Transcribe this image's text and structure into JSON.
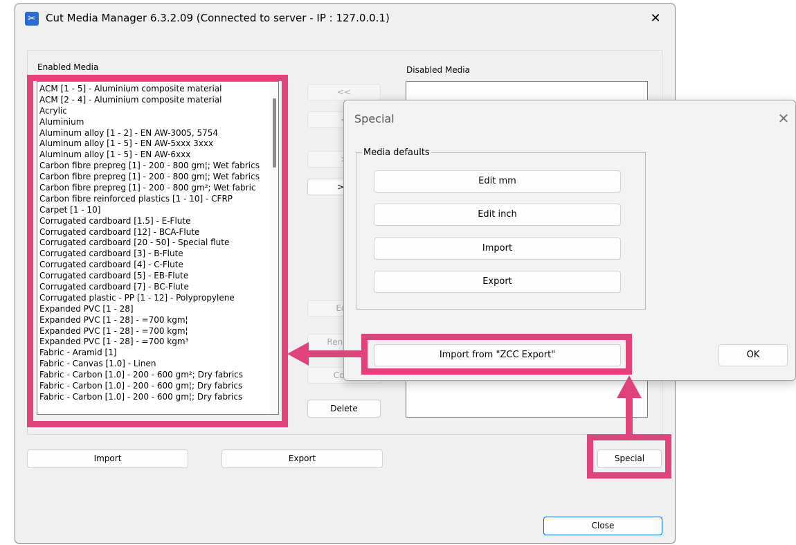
{
  "window": {
    "title": "Cut Media Manager 6.3.2.09 (Connected to server - IP : 127.0.0.1)",
    "close_glyph": "✕",
    "app_icon": "scissors-icon"
  },
  "enabled_media": {
    "label": "Enabled Media",
    "items": [
      "ACM [1 - 5] - Aluminium composite material",
      "ACM [2 - 4] - Aluminium composite material",
      "Acrylic",
      "Aluminium",
      "Aluminum alloy [1 - 2] - EN AW-3005, 5754",
      "Aluminum alloy [1 - 5] - EN AW-5xxx 3xxx",
      "Aluminum alloy [1 - 5] - EN AW-6xxx",
      "Carbon fibre prepreg [1] - 200 - 800 gm¦; Wet fabrics",
      "Carbon fibre prepreg [1] - 200 - 800 gm¦; Wet fabrics",
      "Carbon fibre prepreg [1] - 200 - 800 gm²; Wet fabric",
      "Carbon fibre reinforced plastics [1 - 10] - CFRP",
      "Carpet [1 - 10]",
      "Corrugated cardboard [1.5] - E-Flute",
      "Corrugated cardboard [12] - BCA-Flute",
      "Corrugated cardboard [20 - 50] - Special flute",
      "Corrugated cardboard [3] - B-Flute",
      "Corrugated cardboard [4] - C-Flute",
      "Corrugated cardboard [5] - EB-Flute",
      "Corrugated cardboard [7] - BC-Flute",
      "Corrugated plastic - PP [1 - 12] - Polypropylene",
      "Expanded PVC [1 - 28]",
      "Expanded PVC [1 - 28] - =700 kgm¦",
      "Expanded PVC [1 - 28] - =700 kgm¦",
      "Expanded PVC [1 - 28] - =700 kgm³",
      "Fabric - Aramid [1]",
      "Fabric - Canvas [1.0] - Linen",
      "Fabric - Carbon  [1.0] - 200 - 600 gm²; Dry fabrics",
      "Fabric - Carbon [1.0] - 200 - 600 gm¦; Dry fabrics",
      "Fabric - Carbon [1.0] - 200 - 600 gm¦; Dry fabrics"
    ]
  },
  "disabled_media": {
    "label": "Disabled Media",
    "items": []
  },
  "middle_buttons": {
    "move_all_left": "<<",
    "move_left": "<",
    "move_right": ">",
    "move_all_right": ">>",
    "edit": "Edit",
    "rename": "Rename",
    "copy": "Copy",
    "delete": "Delete"
  },
  "bottom_buttons": {
    "import": "Import",
    "export": "Export",
    "special": "Special",
    "close": "Close"
  },
  "special_dialog": {
    "title": "Special",
    "close_glyph": "✕",
    "group_label": "Media defaults",
    "edit_mm": "Edit mm",
    "edit_inch": "Edit inch",
    "import": "Import",
    "export": "Export",
    "import_zcc": "Import from \"ZCC Export\"",
    "ok": "OK"
  },
  "colors": {
    "highlight": "#e0427b",
    "accent": "#0067c0"
  }
}
